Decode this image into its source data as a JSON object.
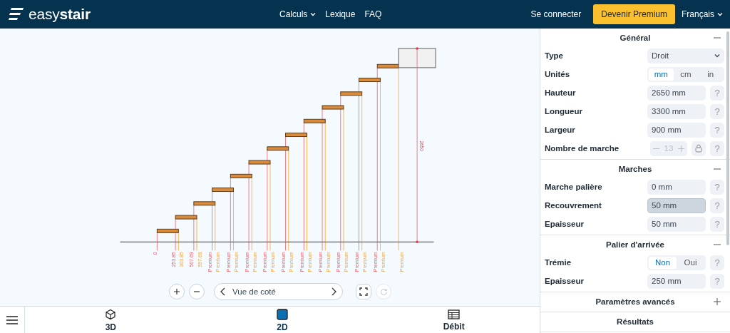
{
  "header": {
    "logo": "easy**stair**",
    "nav": [
      {
        "label": "Calculs",
        "dropdown": true
      },
      {
        "label": "Lexique",
        "dropdown": false
      },
      {
        "label": "FAQ",
        "dropdown": false
      }
    ],
    "login": "Se connecter",
    "premium": "Devenir Premium",
    "language": {
      "label": "Français",
      "dropdown": true
    }
  },
  "drawing": {
    "dimension_labels": [
      {
        "kind": "start",
        "text": "0"
      },
      {
        "kind": "start",
        "text": "253.85"
      },
      {
        "kind": "end",
        "text": "303.85"
      },
      {
        "kind": "start",
        "text": "507.69"
      },
      {
        "kind": "end",
        "text": "557.69"
      },
      {
        "kind": "start",
        "text": "Premium"
      },
      {
        "kind": "end",
        "text": "Premium"
      },
      {
        "kind": "start",
        "text": "Premium"
      },
      {
        "kind": "end",
        "text": "Premium"
      },
      {
        "kind": "start",
        "text": "Premium"
      },
      {
        "kind": "end",
        "text": "Premium"
      },
      {
        "kind": "start",
        "text": "Premium"
      },
      {
        "kind": "end",
        "text": "Premium"
      },
      {
        "kind": "start",
        "text": "Premium"
      },
      {
        "kind": "end",
        "text": "Premium"
      },
      {
        "kind": "start",
        "text": "Premium"
      },
      {
        "kind": "end",
        "text": "Premium"
      },
      {
        "kind": "start",
        "text": "Premium"
      },
      {
        "kind": "end",
        "text": "Premium"
      },
      {
        "kind": "start",
        "text": "Premium"
      },
      {
        "kind": "end",
        "text": "Premium"
      },
      {
        "kind": "start",
        "text": "Premium"
      },
      {
        "kind": "end",
        "text": "Premium"
      },
      {
        "kind": "start",
        "text": "Premium"
      },
      {
        "kind": "end",
        "text": "Premium"
      },
      {
        "kind": "end",
        "text": "Premium"
      }
    ],
    "height_label": "2650"
  },
  "view_controls": {
    "view_label": "Vue de coté",
    "reset_disabled": true
  },
  "bottom_tabs": [
    {
      "label": "3D",
      "selected": false
    },
    {
      "label": "2D",
      "selected": true
    },
    {
      "label": "Débit",
      "selected": false
    }
  ],
  "panel": {
    "sections": [
      {
        "title": "Général",
        "expanded": true,
        "rows": [
          {
            "kind": "select",
            "label": "Type",
            "value": "Droit"
          },
          {
            "kind": "segmented",
            "label": "Unités",
            "options": [
              {
                "label": "mm",
                "selected": true
              },
              {
                "label": "cm",
                "selected": false
              },
              {
                "label": "in",
                "selected": false
              }
            ]
          },
          {
            "kind": "field",
            "label": "Hauteur",
            "value": "2650 mm",
            "focused": false,
            "help": "?"
          },
          {
            "kind": "field",
            "label": "Longueur",
            "value": "3300 mm",
            "focused": false,
            "help": "?"
          },
          {
            "kind": "field",
            "label": "Largeur",
            "value": "900 mm",
            "focused": false,
            "help": "?"
          },
          {
            "kind": "stepper",
            "label": "Nombre de marche",
            "value": "13",
            "disabled": true,
            "help": "?"
          }
        ]
      },
      {
        "title": "Marches",
        "expanded": true,
        "rows": [
          {
            "kind": "field",
            "label": "Marche palière",
            "value": "0 mm",
            "focused": false,
            "help": "?"
          },
          {
            "kind": "field",
            "label": "Recouvrement",
            "value": "50 mm",
            "focused": true,
            "help": "?"
          },
          {
            "kind": "field",
            "label": "Epaisseur",
            "value": "50 mm",
            "focused": false,
            "help": "?"
          }
        ]
      },
      {
        "title": "Palier d'arrivée",
        "expanded": true,
        "rows": [
          {
            "kind": "segmented",
            "label": "Trémie",
            "options": [
              {
                "label": "Non",
                "selected": true
              },
              {
                "label": "Oui",
                "selected": false
              }
            ],
            "help": "?"
          },
          {
            "kind": "field",
            "label": "Epaisseur",
            "value": "250 mm",
            "focused": false,
            "help": "?"
          }
        ]
      },
      {
        "title": "Paramètres avancés",
        "expanded": false
      },
      {
        "title": "Résultats"
      }
    ]
  }
}
